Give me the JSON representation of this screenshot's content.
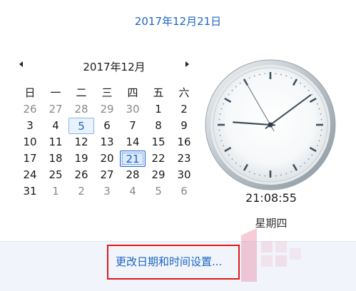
{
  "header": {
    "date_long": "2017年12月21日"
  },
  "calendar": {
    "month_title": "2017年12月",
    "weekdays": [
      "日",
      "一",
      "二",
      "三",
      "四",
      "五",
      "六"
    ],
    "weeks": [
      [
        {
          "d": "26",
          "s": "out"
        },
        {
          "d": "27",
          "s": "out"
        },
        {
          "d": "28",
          "s": "out"
        },
        {
          "d": "29",
          "s": "out"
        },
        {
          "d": "30",
          "s": "out"
        },
        {
          "d": "1",
          "s": "in"
        },
        {
          "d": "2",
          "s": "in"
        }
      ],
      [
        {
          "d": "3",
          "s": "in"
        },
        {
          "d": "4",
          "s": "in"
        },
        {
          "d": "5",
          "s": "today"
        },
        {
          "d": "6",
          "s": "in"
        },
        {
          "d": "7",
          "s": "in"
        },
        {
          "d": "8",
          "s": "in"
        },
        {
          "d": "9",
          "s": "in"
        }
      ],
      [
        {
          "d": "10",
          "s": "in"
        },
        {
          "d": "11",
          "s": "in"
        },
        {
          "d": "12",
          "s": "in"
        },
        {
          "d": "13",
          "s": "in"
        },
        {
          "d": "14",
          "s": "in"
        },
        {
          "d": "15",
          "s": "in"
        },
        {
          "d": "16",
          "s": "in"
        }
      ],
      [
        {
          "d": "17",
          "s": "in"
        },
        {
          "d": "18",
          "s": "in"
        },
        {
          "d": "19",
          "s": "in"
        },
        {
          "d": "20",
          "s": "in"
        },
        {
          "d": "21",
          "s": "selected"
        },
        {
          "d": "22",
          "s": "in"
        },
        {
          "d": "23",
          "s": "in"
        }
      ],
      [
        {
          "d": "24",
          "s": "in"
        },
        {
          "d": "25",
          "s": "in"
        },
        {
          "d": "26",
          "s": "in"
        },
        {
          "d": "27",
          "s": "in"
        },
        {
          "d": "28",
          "s": "in"
        },
        {
          "d": "29",
          "s": "in"
        },
        {
          "d": "30",
          "s": "in"
        }
      ],
      [
        {
          "d": "31",
          "s": "in"
        },
        {
          "d": "1",
          "s": "out"
        },
        {
          "d": "2",
          "s": "out"
        },
        {
          "d": "3",
          "s": "out"
        },
        {
          "d": "4",
          "s": "out"
        },
        {
          "d": "5",
          "s": "out"
        },
        {
          "d": "6",
          "s": "out"
        }
      ]
    ]
  },
  "clock": {
    "time": "21:08:55",
    "weekday": "星期四",
    "hours": 21,
    "minutes": 8,
    "seconds": 55
  },
  "footer": {
    "settings_link": "更改日期和时间设置..."
  },
  "colors": {
    "link": "#1d64c4",
    "highlight_border": "#e01919",
    "selected_border": "#2f6bd3",
    "watermark": "#e88ea8"
  },
  "icons": {
    "prev": "triangle-left-icon",
    "next": "triangle-right-icon"
  }
}
